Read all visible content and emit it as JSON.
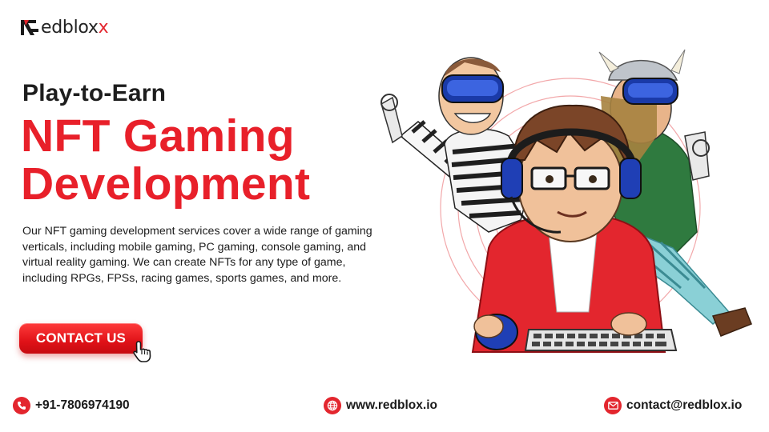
{
  "brand": {
    "logo_text": "edblox",
    "logo_x": "x",
    "accent": "#e8202a"
  },
  "hero": {
    "subtitle": "Play-to-Earn",
    "headline_line1": "NFT Gaming",
    "headline_line2": "Development",
    "description": "Our NFT gaming development services cover a wide range of gaming verticals, including mobile gaming, PC gaming, console gaming, and virtual reality gaming. We can create NFTs for any type of game, including RPGs, FPSs, racing games, sports games, and more.",
    "cta_label": "CONTACT US"
  },
  "footer": {
    "phone": "+91-7806974190",
    "website": "www.redblox.io",
    "email": "contact@redblox.io"
  },
  "icons": [
    "logo-r-icon",
    "pointer-cursor-icon",
    "phone-icon",
    "globe-icon",
    "mail-icon"
  ]
}
